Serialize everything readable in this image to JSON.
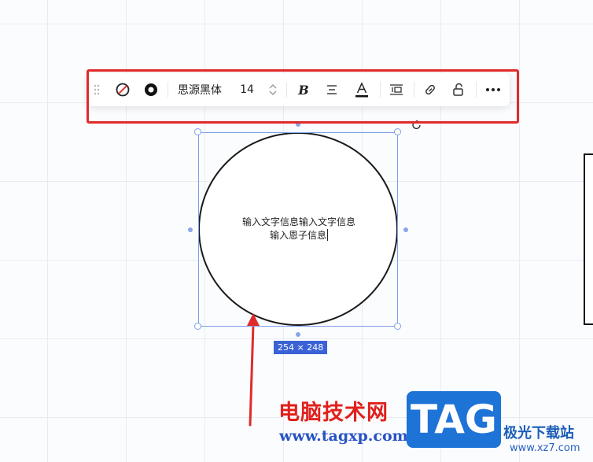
{
  "toolbar": {
    "font_name": "思源黑体",
    "font_size": "14",
    "buttons": [
      "drag-handle",
      "no-fill",
      "border-style",
      "font-family",
      "font-size",
      "bold",
      "align",
      "text-color",
      "line-spacing",
      "link",
      "lock",
      "more"
    ]
  },
  "shape": {
    "text_line1": "输入文字信息输入文字信息",
    "text_line2": "输入恩子信息",
    "size_label": "254 × 248"
  },
  "watermark": {
    "site_cn": "电脑技术网",
    "site_url": "www.tagxp.com",
    "logo_text": "TAG",
    "partner_cn": "极光下载站",
    "partner_url": "www.xz7.com"
  },
  "colors": {
    "highlight": "#e02b2b",
    "selection": "#7da0ea",
    "badge": "#3a62d6",
    "arrow": "#e02b2b"
  }
}
